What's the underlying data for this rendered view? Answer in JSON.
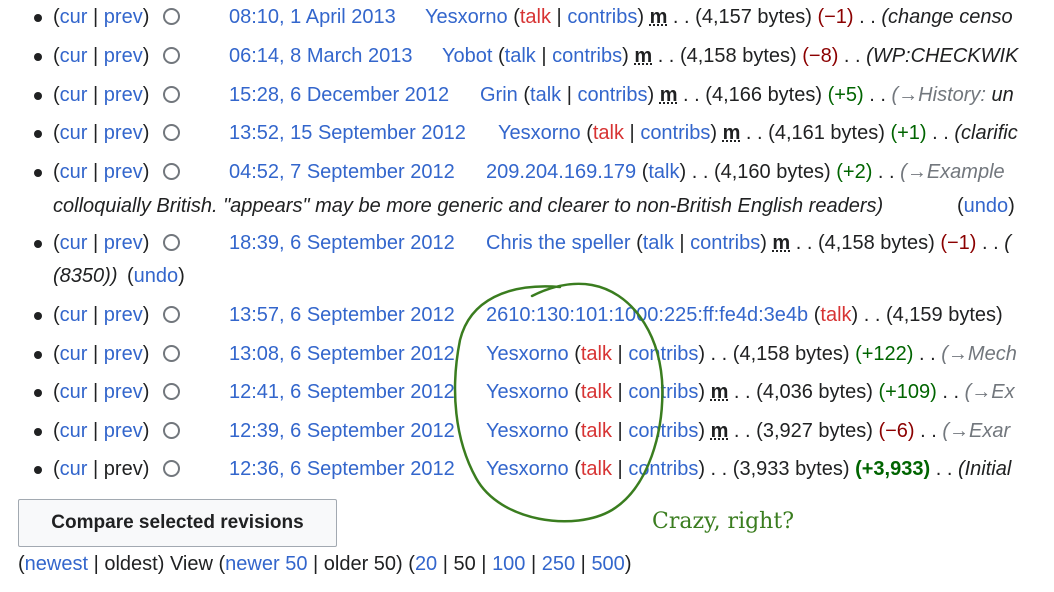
{
  "history": {
    "rows": [
      {
        "cur": "cur",
        "prev": "prev",
        "prev_link": true,
        "date": "08:10, 1 April 2013",
        "user": "Yesxorno",
        "talk": "talk",
        "talk_red": true,
        "contribs": "contribs",
        "minor": "m",
        "bytes": "(4,157 bytes)",
        "diff": "(−1)",
        "diff_class": "neg",
        "summary": "(change censo",
        "summary_gray": ""
      },
      {
        "cur": "cur",
        "prev": "prev",
        "prev_link": true,
        "date": "06:14, 8 March 2013",
        "user": "Yobot",
        "talk": "talk",
        "talk_red": false,
        "contribs": "contribs",
        "minor": "m",
        "bytes": "(4,158 bytes)",
        "diff": "(−8)",
        "diff_class": "neg",
        "summary": "(WP:CHECKWIK",
        "summary_gray": ""
      },
      {
        "cur": "cur",
        "prev": "prev",
        "prev_link": true,
        "date": "15:28, 6 December 2012",
        "user": "Grin",
        "talk": "talk",
        "talk_red": false,
        "contribs": "contribs",
        "minor": "m",
        "bytes": "(4,166 bytes)",
        "diff": "(+5)",
        "diff_class": "pos",
        "summary": "un",
        "summary_gray": "(→History:"
      },
      {
        "cur": "cur",
        "prev": "prev",
        "prev_link": true,
        "date": "13:52, 15 September 2012",
        "user": "Yesxorno",
        "talk": "talk",
        "talk_red": true,
        "contribs": "contribs",
        "minor": "m",
        "bytes": "(4,161 bytes)",
        "diff": "(+1)",
        "diff_class": "pos",
        "summary": "(clarific",
        "summary_gray": ""
      },
      {
        "cur": "cur",
        "prev": "prev",
        "prev_link": true,
        "date": "04:52, 7 September 2012",
        "user": "209.204.169.179",
        "talk": "talk",
        "talk_red": false,
        "contribs": "",
        "minor": "",
        "bytes": "(4,160 bytes)",
        "diff": "(+2)",
        "diff_class": "pos",
        "summary": "",
        "summary_gray": "(→Example"
      },
      {
        "cur": "cur",
        "prev": "prev",
        "prev_link": true,
        "date": "18:39, 6 September 2012",
        "user": "Chris the speller",
        "talk": "talk",
        "talk_red": false,
        "contribs": "contribs",
        "minor": "m",
        "bytes": "(4,158 bytes)",
        "diff": "(−1)",
        "diff_class": "neg",
        "summary": "(",
        "summary_gray": ""
      },
      {
        "cur": "cur",
        "prev": "prev",
        "prev_link": true,
        "date": "13:57, 6 September 2012",
        "user": "2610:130:101:1000:225:ff:fe4d:3e4b",
        "talk": "talk",
        "talk_red": true,
        "contribs": "",
        "minor": "",
        "bytes": "(4,159 bytes)",
        "diff": "",
        "diff_class": "",
        "summary": "",
        "summary_gray": ""
      },
      {
        "cur": "cur",
        "prev": "prev",
        "prev_link": true,
        "date": "13:08, 6 September 2012",
        "user": "Yesxorno",
        "talk": "talk",
        "talk_red": true,
        "contribs": "contribs",
        "minor": "",
        "bytes": "(4,158 bytes)",
        "diff": "(+122)",
        "diff_class": "pos",
        "summary": "",
        "summary_gray": "(→Mech"
      },
      {
        "cur": "cur",
        "prev": "prev",
        "prev_link": true,
        "date": "12:41, 6 September 2012",
        "user": "Yesxorno",
        "talk": "talk",
        "talk_red": true,
        "contribs": "contribs",
        "minor": "m",
        "bytes": "(4,036 bytes)",
        "diff": "(+109)",
        "diff_class": "pos",
        "summary": "",
        "summary_gray": "(→Ex"
      },
      {
        "cur": "cur",
        "prev": "prev",
        "prev_link": true,
        "date": "12:39, 6 September 2012",
        "user": "Yesxorno",
        "talk": "talk",
        "talk_red": true,
        "contribs": "contribs",
        "minor": "m",
        "bytes": "(3,927 bytes)",
        "diff": "(−6)",
        "diff_class": "neg",
        "summary": "",
        "summary_gray": "(→Exar"
      },
      {
        "cur": "cur",
        "prev": "prev",
        "prev_link": false,
        "date": "12:36, 6 September 2012",
        "user": "Yesxorno",
        "talk": "talk",
        "talk_red": true,
        "contribs": "contribs",
        "minor": "",
        "bytes": "(3,933 bytes)",
        "diff": "(+3,933)",
        "diff_class": "pos bold",
        "summary": "(Initial",
        "summary_gray": ""
      }
    ],
    "continuation_1": {
      "text": "colloquially British. \"appears\" may be more generic and clearer to non-British English readers)",
      "undo": "undo"
    },
    "continuation_2": {
      "text": "(8350))",
      "undo": "undo"
    }
  },
  "compare_button": "Compare selected revisions",
  "annotation": "Crazy, right?",
  "annotation_color": "#3a7d1f",
  "pager": {
    "newest": "newest",
    "oldest": "oldest",
    "view": "View",
    "newer": "newer 50",
    "older": "older 50",
    "limits": [
      "20",
      "50",
      "100",
      "250",
      "500"
    ],
    "active_limit": "50"
  },
  "icons": {
    "bullet": "bullet-dot",
    "radio": "radio-circle"
  }
}
